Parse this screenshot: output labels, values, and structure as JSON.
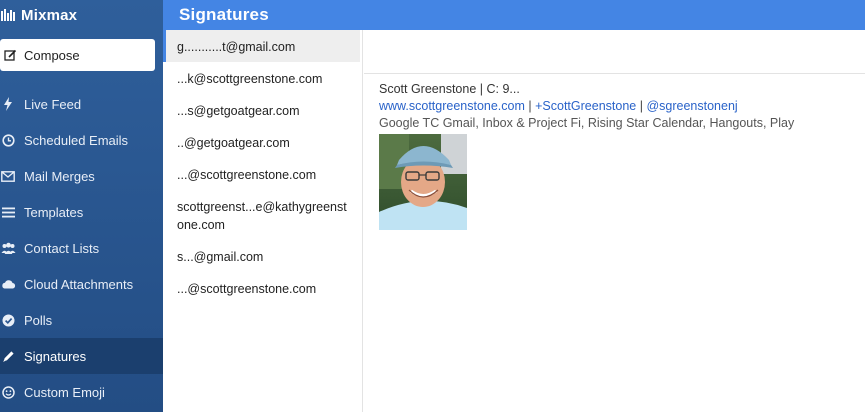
{
  "app": {
    "name": "Mixmax"
  },
  "sidebar": {
    "compose_label": "Compose",
    "items": [
      {
        "label": "Live Feed",
        "icon": "bolt-icon"
      },
      {
        "label": "Scheduled Emails",
        "icon": "clock-icon"
      },
      {
        "label": "Mail Merges",
        "icon": "envelope-icon"
      },
      {
        "label": "Templates",
        "icon": "list-icon"
      },
      {
        "label": "Contact Lists",
        "icon": "users-icon"
      },
      {
        "label": "Cloud Attachments",
        "icon": "cloud-icon"
      },
      {
        "label": "Polls",
        "icon": "check-circle-icon"
      },
      {
        "label": "Signatures",
        "icon": "pencil-icon",
        "active": true
      },
      {
        "label": "Custom Emoji",
        "icon": "smiley-icon"
      }
    ]
  },
  "header": {
    "title": "Signatures"
  },
  "emails": [
    {
      "address": "g...........t@gmail.com"
    },
    {
      "address": "...k@scottgreenstone.com"
    },
    {
      "address": "...s@getgoatgear.com"
    },
    {
      "address": "..@getgoatgear.com"
    },
    {
      "address": "...@scottgreenstone.com"
    },
    {
      "address": "scottgreenst...e@kathygreenstone.com"
    },
    {
      "address": "s...@gmail.com"
    },
    {
      "address": "...@scottgreenstone.com"
    }
  ],
  "signature": {
    "line1": "Scott Greenstone | C: 9...",
    "website": "www.scottgreenstone.com",
    "gplus": "+ScottGreenstone",
    "twitter": "@sgreenstonenj",
    "sep": "|",
    "description": "Google TC Gmail, Inbox & Project Fi, Rising Star Calendar, Hangouts, Play"
  },
  "colors": {
    "sidebar": "#2f5f9b",
    "header": "#4485e4",
    "active_nav": "#1b3f6e",
    "link": "#2a63c9"
  }
}
